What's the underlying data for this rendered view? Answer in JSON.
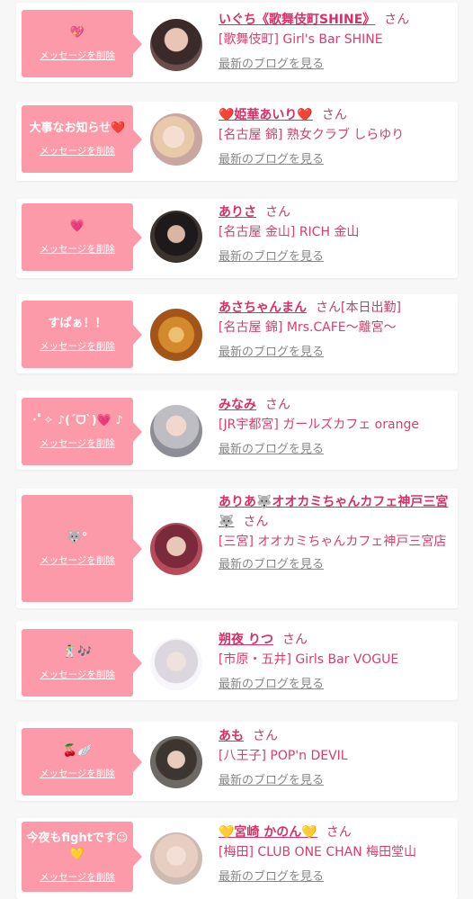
{
  "delete_label": "メッセージを削除",
  "san_label": "さん",
  "blog_label": "最新のブログを見る",
  "colors": {
    "bubble": "#fd9aa9",
    "name": "#d92f67",
    "shop": "#d43f6e",
    "background": "#f7f7f7"
  },
  "entries": [
    {
      "message": "💖",
      "name": "いぐち《歌舞伎町SHINE》",
      "status": "",
      "shop": "[歌舞伎町] Girl's Bar SHINE",
      "avatar": "portrait-woman-dark-hair"
    },
    {
      "message": "大事なお知らせ❤️",
      "name": "❤️姫華あいり❤️",
      "status": "",
      "shop": "[名古屋 錦] 熟女クラブ しらゆり",
      "avatar": "portrait-woman-blonde"
    },
    {
      "message": "💗",
      "name": "ありさ",
      "status": "",
      "shop": "[名古屋 金山] RICH 金山",
      "avatar": "portrait-woman-dark-room"
    },
    {
      "message": "すぱぁ！！",
      "name": "あさちゃんまん",
      "status": "[本日出勤]",
      "shop": "[名古屋 錦] Mrs.CAFE〜離宮〜",
      "avatar": "bread-face-character"
    },
    {
      "message": "･ﾟ✧ ♪(ˊᗜˋ)💗 ♪",
      "name": "みなみ",
      "status": "",
      "shop": "[JR宇都宮] ガールズカフェ orange",
      "avatar": "portrait-woman-silver-hair"
    },
    {
      "message": "🐺°",
      "name": "ありあ🐺オオカミちゃんカフェ神戸三宮🐺",
      "status": "",
      "shop": "[三宮] オオカミちゃんカフェ神戸三宮店",
      "avatar": "portrait-woman-red-room"
    },
    {
      "message": "🕺🎶",
      "name": "朔夜 りつ",
      "status": "",
      "shop": "[市原・五井] Girls Bar VOGUE",
      "avatar": "portrait-woman-white-background"
    },
    {
      "message": "🍒🪽",
      "name": "あも",
      "status": "",
      "shop": "[八王子] POP'n DEVIL",
      "avatar": "portrait-woman-glasses"
    },
    {
      "message": "今夜もfightです😉💛",
      "name": "💛宮崎 かのん💛",
      "status": "",
      "shop": "[梅田] CLUB ONE CHAN 梅田堂山",
      "avatar": "portrait-woman-light-hair"
    }
  ]
}
